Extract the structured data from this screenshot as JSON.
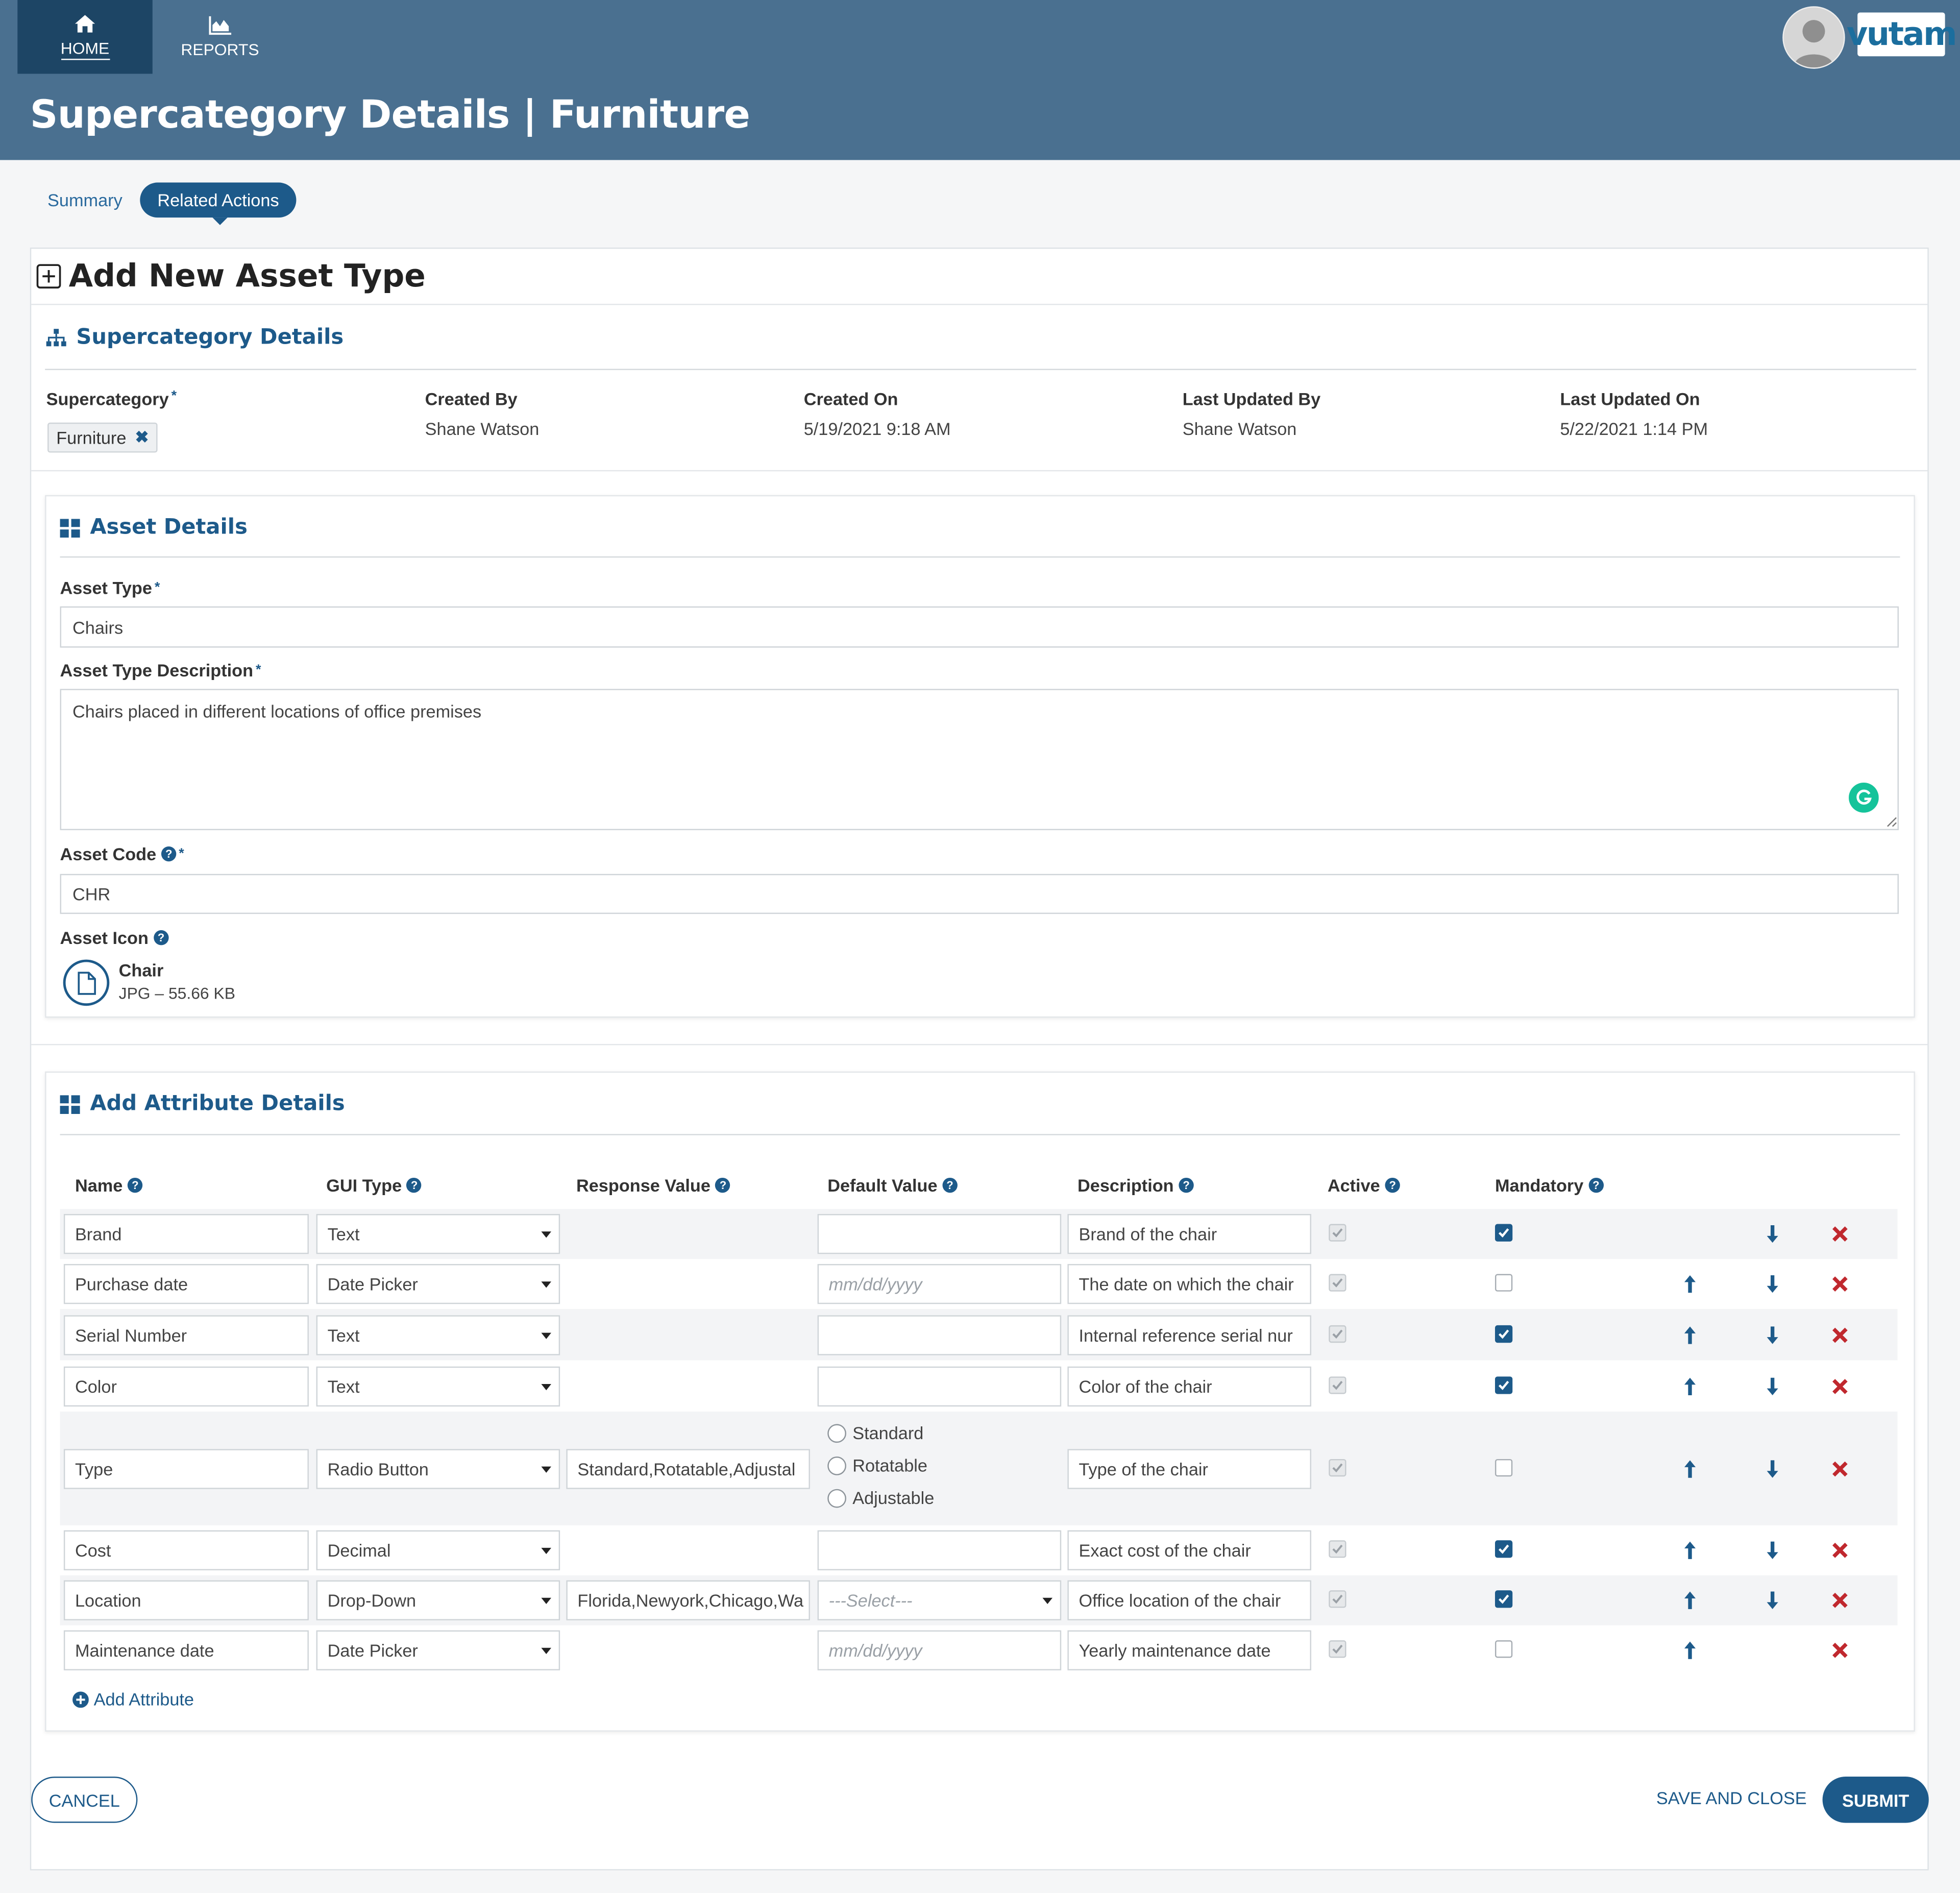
{
  "nav": {
    "home_label": "HOME",
    "reports_label": "REPORTS"
  },
  "brand": {
    "logo_text": "vutam"
  },
  "page": {
    "title": "Supercategory Details | Furniture"
  },
  "tabs": [
    {
      "label": "Summary",
      "active": false
    },
    {
      "label": "Related Actions",
      "active": true
    }
  ],
  "form": {
    "title": "Add New Asset Type"
  },
  "supercategory_section": {
    "title": "Supercategory Details",
    "supercategory_label": "Supercategory",
    "supercategory_value": "Furniture",
    "created_by_label": "Created By",
    "created_by": "Shane Watson",
    "created_on_label": "Created On",
    "created_on": "5/19/2021 9:18 AM",
    "last_updated_by_label": "Last Updated By",
    "last_updated_by": "Shane Watson",
    "last_updated_on_label": "Last Updated On",
    "last_updated_on": "5/22/2021 1:14 PM"
  },
  "asset_section": {
    "title": "Asset Details",
    "asset_type_label": "Asset Type",
    "asset_type_value": "Chairs",
    "description_label": "Asset Type Description",
    "description_value": "Chairs placed in different locations of office premises",
    "code_label": "Asset Code",
    "code_value": "CHR",
    "icon_label": "Asset Icon",
    "icon_file_name": "Chair",
    "icon_file_meta": "JPG – 55.66 KB"
  },
  "attributes_section": {
    "title": "Add Attribute Details",
    "columns": [
      "Name",
      "GUI Type",
      "Response Value",
      "Default Value",
      "Description",
      "Active",
      "Mandatory"
    ],
    "rows": [
      {
        "name": "Brand",
        "gui_type": "Text",
        "response": "",
        "default": "",
        "default_placeholder": "",
        "description": "Brand of the chair",
        "active": true,
        "mandatory": true,
        "up": false,
        "down": true
      },
      {
        "name": "Purchase date",
        "gui_type": "Date Picker",
        "response": "",
        "default": "",
        "default_placeholder": "mm/dd/yyyy",
        "description": "The date on which the chair",
        "active": true,
        "mandatory": false,
        "up": true,
        "down": true
      },
      {
        "name": "Serial Number",
        "gui_type": "Text",
        "response": "",
        "default": "",
        "default_placeholder": "",
        "description": "Internal reference serial nur",
        "active": true,
        "mandatory": true,
        "up": true,
        "down": true
      },
      {
        "name": "Color",
        "gui_type": "Text",
        "response": "",
        "default": "",
        "default_placeholder": "",
        "description": "Color of the chair",
        "active": true,
        "mandatory": true,
        "up": true,
        "down": true
      },
      {
        "name": "Type",
        "gui_type": "Radio Button",
        "response": "Standard,Rotatable,Adjustal",
        "default": "",
        "default_placeholder": "",
        "description": "Type of the chair",
        "active": true,
        "mandatory": false,
        "up": true,
        "down": true,
        "radio_options": [
          "Standard",
          "Rotatable",
          "Adjustable"
        ]
      },
      {
        "name": "Cost",
        "gui_type": "Decimal",
        "response": "",
        "default": "",
        "default_placeholder": "",
        "description": "Exact cost of the chair",
        "active": true,
        "mandatory": true,
        "up": true,
        "down": true
      },
      {
        "name": "Location",
        "gui_type": "Drop-Down",
        "response": "Florida,Newyork,Chicago,Wa",
        "default": "",
        "default_placeholder": "---Select---",
        "description": "Office location of the chair",
        "active": true,
        "mandatory": true,
        "up": true,
        "down": true
      },
      {
        "name": "Maintenance date",
        "gui_type": "Date Picker",
        "response": "",
        "default": "",
        "default_placeholder": "mm/dd/yyyy",
        "description": "Yearly maintenance date",
        "active": true,
        "mandatory": false,
        "up": true,
        "down": false
      }
    ],
    "add_attribute_label": "Add Attribute"
  },
  "footer": {
    "cancel_label": "CANCEL",
    "save_close_label": "SAVE AND CLOSE",
    "submit_label": "SUBMIT"
  },
  "colors": {
    "header_bg": "#4a7090",
    "nav_active": "#1d4565",
    "accent": "#1d5a8a",
    "delete": "#c0282e"
  }
}
